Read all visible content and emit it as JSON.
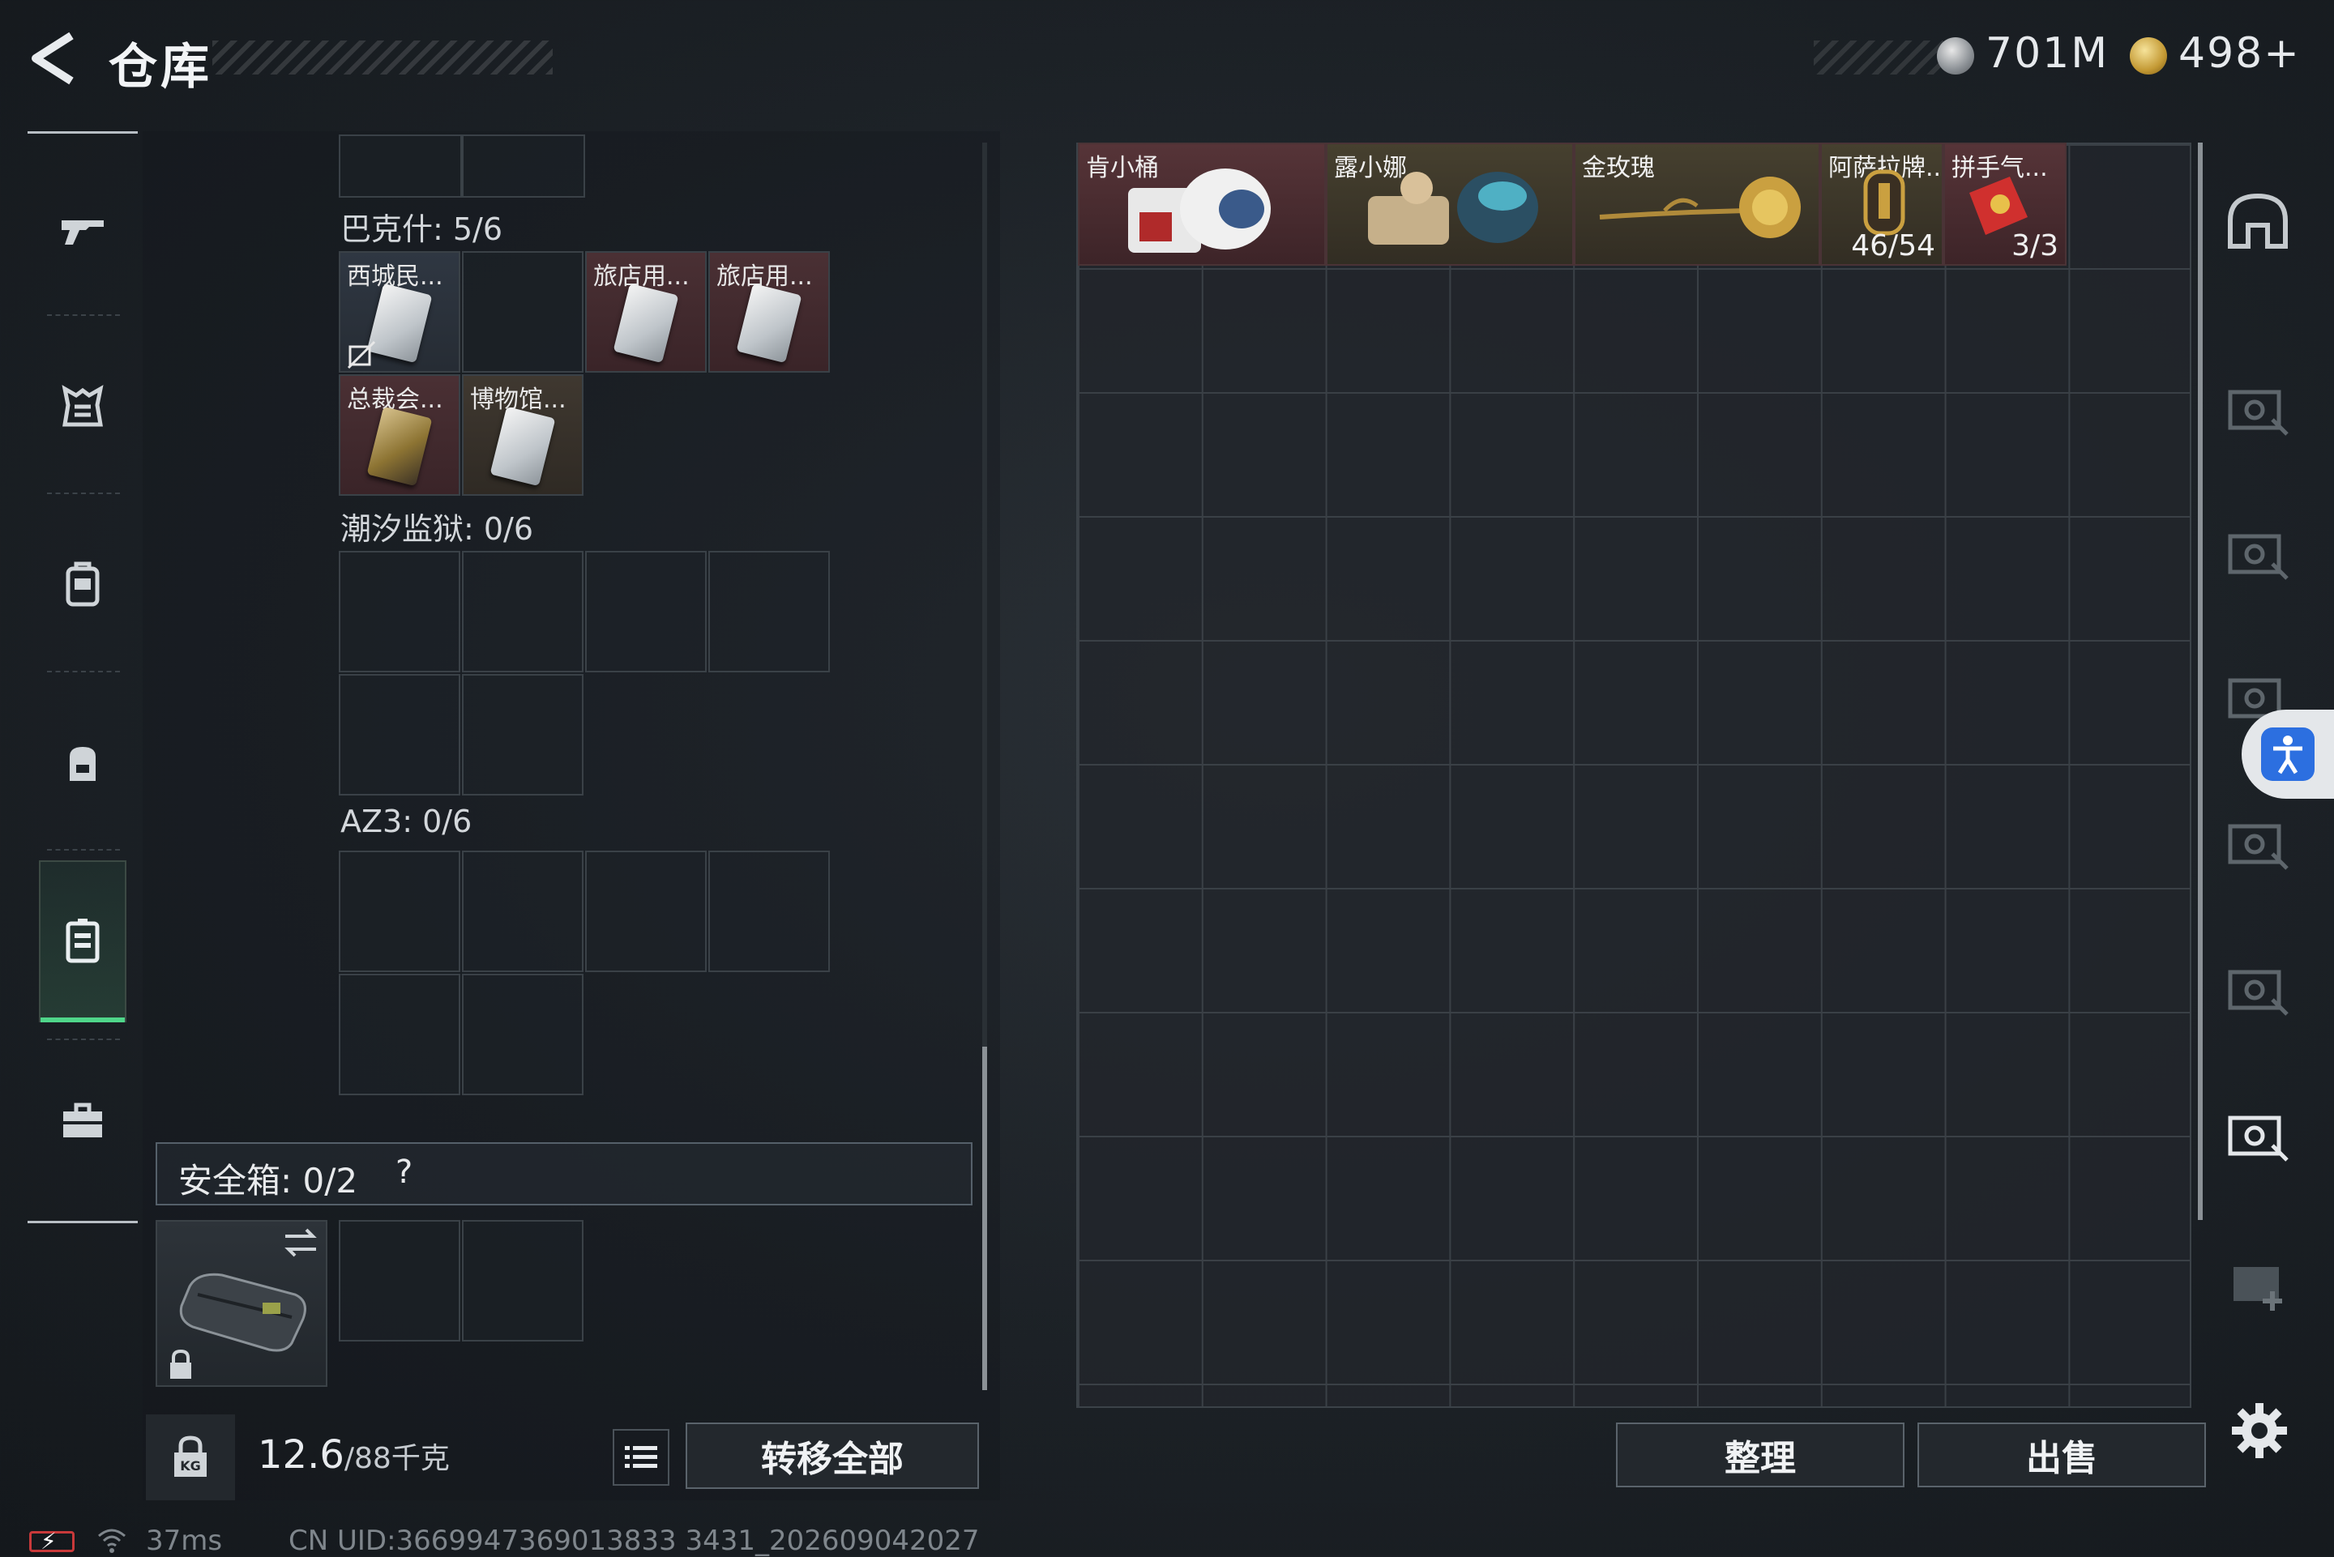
{
  "header": {
    "title": "仓库",
    "silver_amount": "701M",
    "gold_amount": "498+"
  },
  "nav": {
    "items": [
      "gun-icon",
      "armor-icon",
      "vest-icon",
      "backpack-icon",
      "keycard-case-icon",
      "toolbox-icon"
    ],
    "active_index": 4
  },
  "inventory": {
    "categories": [
      {
        "name": "巴克什: 5/6"
      },
      {
        "name": "潮汐监狱: 0/6"
      },
      {
        "name": "AZ3: 0/6"
      }
    ],
    "bakshi_items": [
      "西城民...",
      "旅店用...",
      "旅店用...",
      "总裁会...",
      "博物馆..."
    ]
  },
  "safe_box": {
    "label": "安全箱: 0/2",
    "help": "?"
  },
  "footer_left": {
    "weight": "12.6",
    "weight_max": "/88千克",
    "transfer_all": "转移全部"
  },
  "storage": {
    "items": [
      {
        "label": "肯小桶",
        "count": ""
      },
      {
        "label": "露小娜",
        "count": ""
      },
      {
        "label": "金玫瑰",
        "count": ""
      },
      {
        "label": "阿萨拉牌...",
        "count": "46/54"
      },
      {
        "label": "拼手气...",
        "count": "3/3"
      }
    ],
    "sort_label": "整理",
    "sell_label": "出售"
  },
  "status_bar": {
    "ping": "37ms",
    "uid": "CN UID:3669947369013833 3431_202609042027"
  },
  "colors": {
    "accent_green": "#4fd68a",
    "item_red": "#563438",
    "item_gold": "#46402f"
  }
}
